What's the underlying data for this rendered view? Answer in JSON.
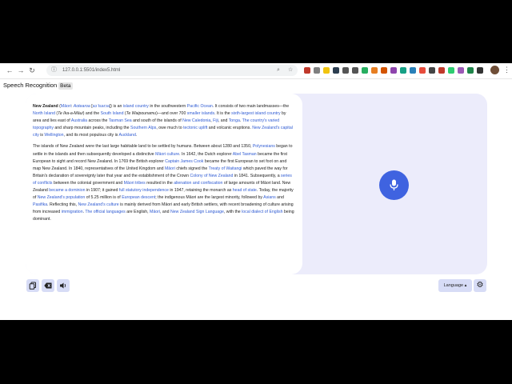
{
  "browser": {
    "url": "127.0.0.1:5501/index5.html"
  },
  "app": {
    "title": "Speech Recognition",
    "badge": "Beta"
  },
  "transcript": {
    "paragraphs": [
      [
        {
          "t": "New Zealand",
          "b": true
        },
        {
          "t": " ("
        },
        {
          "t": "Māori",
          "link": true
        },
        {
          "t": ": "
        },
        {
          "t": "Aotearoa",
          "link": true,
          "i": true
        },
        {
          "t": " ["
        },
        {
          "t": "aɔˈtɛaɾɔa",
          "link": true
        },
        {
          "t": "]) is an "
        },
        {
          "t": "island country",
          "link": true
        },
        {
          "t": " in the southwestern "
        },
        {
          "t": "Pacific Ocean",
          "link": true
        },
        {
          "t": ". It consists of two main landmasses—the "
        },
        {
          "t": "North Island",
          "link": true
        },
        {
          "t": " ("
        },
        {
          "t": "Te Ika-a-Māui",
          "i": true
        },
        {
          "t": ") and the "
        },
        {
          "t": "South Island",
          "link": true
        },
        {
          "t": " ("
        },
        {
          "t": "Te Waipounamu",
          "i": true
        },
        {
          "t": ")—and over 700 "
        },
        {
          "t": "smaller islands",
          "link": true
        },
        {
          "t": ". It is the "
        },
        {
          "t": "sixth-largest island country",
          "link": true
        },
        {
          "t": " by area and lies east of "
        },
        {
          "t": "Australia",
          "link": true
        },
        {
          "t": " across the "
        },
        {
          "t": "Tasman Sea",
          "link": true
        },
        {
          "t": " and south of the islands of "
        },
        {
          "t": "New Caledonia",
          "link": true
        },
        {
          "t": ", "
        },
        {
          "t": "Fiji",
          "link": true
        },
        {
          "t": ", and "
        },
        {
          "t": "Tonga",
          "link": true
        },
        {
          "t": ". "
        },
        {
          "t": "The country's varied topography",
          "link": true
        },
        {
          "t": " and sharp mountain peaks, including the "
        },
        {
          "t": "Southern Alps",
          "link": true
        },
        {
          "t": ", owe much to "
        },
        {
          "t": "tectonic uplift",
          "link": true
        },
        {
          "t": " and volcanic eruptions. "
        },
        {
          "t": "New Zealand's capital city",
          "link": true
        },
        {
          "t": " is "
        },
        {
          "t": "Wellington",
          "link": true
        },
        {
          "t": ", and its most populous city is "
        },
        {
          "t": "Auckland",
          "link": true
        },
        {
          "t": "."
        }
      ],
      [
        {
          "t": "The islands of New Zealand were the last large habitable land to be settled by humans. Between about 1280 and 1350, "
        },
        {
          "t": "Polynesians",
          "link": true
        },
        {
          "t": " began to settle in the islands and then subsequently developed a distinctive "
        },
        {
          "t": "Māori culture",
          "link": true
        },
        {
          "t": ". In 1642, the Dutch explorer "
        },
        {
          "t": "Abel Tasman",
          "link": true
        },
        {
          "t": " became the first European to sight and record New Zealand. In 1769 the British explorer "
        },
        {
          "t": "Captain James Cook",
          "link": true
        },
        {
          "t": " became the first European to set foot on and map New Zealand. In 1840, representatives of the United Kingdom and "
        },
        {
          "t": "Māori",
          "link": true
        },
        {
          "t": " chiefs signed the "
        },
        {
          "t": "Treaty of Waitangi",
          "link": true
        },
        {
          "t": " which paved the way for Britain's declaration of sovereignty later that year and the establishment of the Crown "
        },
        {
          "t": "Colony of New Zealand",
          "link": true
        },
        {
          "t": " in 1841. Subsequently, a "
        },
        {
          "t": "series of conflicts",
          "link": true
        },
        {
          "t": " between the colonial government and "
        },
        {
          "t": "Māori tribes",
          "link": true
        },
        {
          "t": " resulted in the "
        },
        {
          "t": "alienation and confiscation",
          "link": true
        },
        {
          "t": " of large amounts of Māori land. New Zealand "
        },
        {
          "t": "became a dominion",
          "link": true
        },
        {
          "t": " in 1907; it gained "
        },
        {
          "t": "full statutory independence",
          "link": true
        },
        {
          "t": " in 1947, retaining the monarch as "
        },
        {
          "t": "head of state",
          "link": true
        },
        {
          "t": ". Today, the majority of "
        },
        {
          "t": "New Zealand's population",
          "link": true
        },
        {
          "t": " of 5.25 million is of "
        },
        {
          "t": "European descent",
          "link": true
        },
        {
          "t": "; the indigenous Māori are the largest minority, followed by "
        },
        {
          "t": "Asians",
          "link": true
        },
        {
          "t": " and "
        },
        {
          "t": "Pasifika",
          "link": true
        },
        {
          "t": ". Reflecting this, "
        },
        {
          "t": "New Zealand's culture",
          "link": true
        },
        {
          "t": " is mainly derived from Māori and early British settlers, with recent broadening of culture arising from increased "
        },
        {
          "t": "immigration",
          "link": true
        },
        {
          "t": ". "
        },
        {
          "t": "The official languages",
          "link": true
        },
        {
          "t": " are English, "
        },
        {
          "t": "Māori",
          "link": true
        },
        {
          "t": ", and "
        },
        {
          "t": "New Zealand Sign Language",
          "link": true
        },
        {
          "t": ", with the "
        },
        {
          "t": "local dialect of English",
          "link": true
        },
        {
          "t": " being dominant."
        }
      ]
    ]
  },
  "controls": {
    "copy_icon": "copy-icon",
    "clear_icon": "backspace-icon",
    "speak_icon": "speaker-icon",
    "language_label": "Language",
    "language_arrow": "▴",
    "settings_icon": "gear-icon",
    "mic_icon": "microphone-icon"
  },
  "colors": {
    "accent": "#3f63e0",
    "panel": "#ececfb",
    "button": "#d7dcf6",
    "link": "#2f5bd3"
  }
}
